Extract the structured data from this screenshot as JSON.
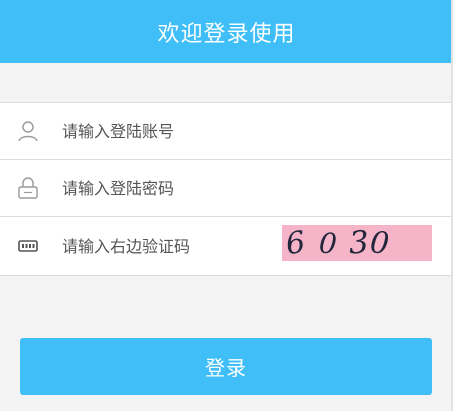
{
  "header": {
    "title": "欢迎登录使用"
  },
  "form": {
    "username": {
      "placeholder": "请输入登陆账号",
      "value": "",
      "icon": "user-icon"
    },
    "password": {
      "placeholder": "请输入登陆密码",
      "value": "",
      "icon": "lock-icon"
    },
    "captcha": {
      "placeholder": "请输入右边验证码",
      "value": "",
      "icon": "keyboard-icon",
      "image_text": "6030",
      "chars": [
        "6",
        "0",
        "3",
        "0"
      ]
    }
  },
  "login_button": {
    "label": "登录"
  },
  "colors": {
    "accent": "#3fbef8",
    "background": "#f3f3f3",
    "captcha_bg": "#f6b4c9"
  }
}
